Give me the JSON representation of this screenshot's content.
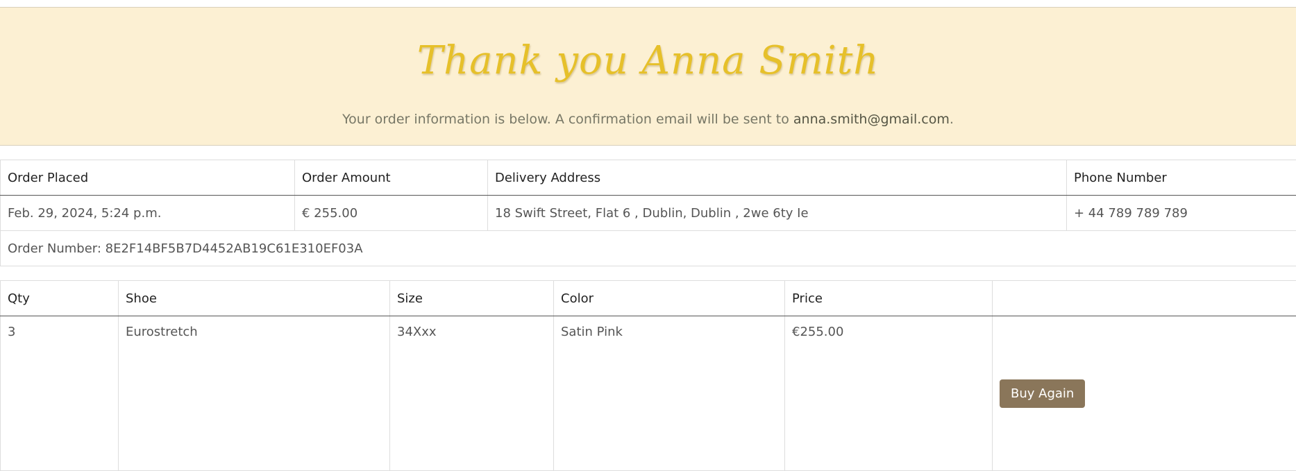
{
  "banner": {
    "title": "Thank you Anna Smith",
    "message_prefix": "Your order information is below. A confirmation email will be sent to ",
    "email": "anna.smith@gmail.com",
    "message_suffix": "."
  },
  "order": {
    "headers": [
      "Order Placed",
      "Order Amount",
      "Delivery Address",
      "Phone Number"
    ],
    "placed": "Feb. 29, 2024, 5:24 p.m.",
    "amount": "€ 255.00",
    "address": "18 Swift Street, Flat 6 , Dublin, Dublin , 2we 6ty Ie",
    "phone": "+ 44 789 789 789",
    "order_number": "Order Number: 8E2F14BF5B7D4452AB19C61E310EF03A"
  },
  "items": {
    "headers": [
      "Qty",
      "Shoe",
      "Size",
      "Color",
      "Price"
    ],
    "rows": [
      {
        "qty": "3",
        "shoe": "Eurostretch",
        "size": "34Xxx",
        "color": "Satin Pink",
        "price": "€255.00"
      }
    ],
    "buy_again_label": "Buy Again"
  }
}
